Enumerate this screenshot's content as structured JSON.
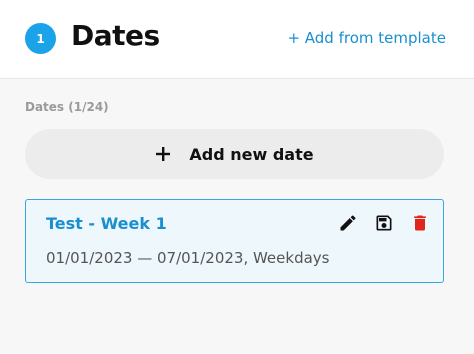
{
  "header": {
    "step_number": "1",
    "title": "Dates",
    "add_template_label": "+ Add from template"
  },
  "dates": {
    "section_label": "Dates (1/24)",
    "add_button_label": "Add new date",
    "items": [
      {
        "title": "Test - Week 1",
        "subtitle": "01/01/2023 — 07/01/2023, Weekdays"
      }
    ]
  },
  "icons": {
    "plus": "plus-icon",
    "edit": "pencil-icon",
    "save": "save-icon",
    "delete": "trash-icon"
  },
  "colors": {
    "accent": "#1aa3e8",
    "link": "#1a8fd0",
    "delete": "#e0261b",
    "card_bg": "#eef7fc",
    "card_border": "#35a9dd"
  }
}
